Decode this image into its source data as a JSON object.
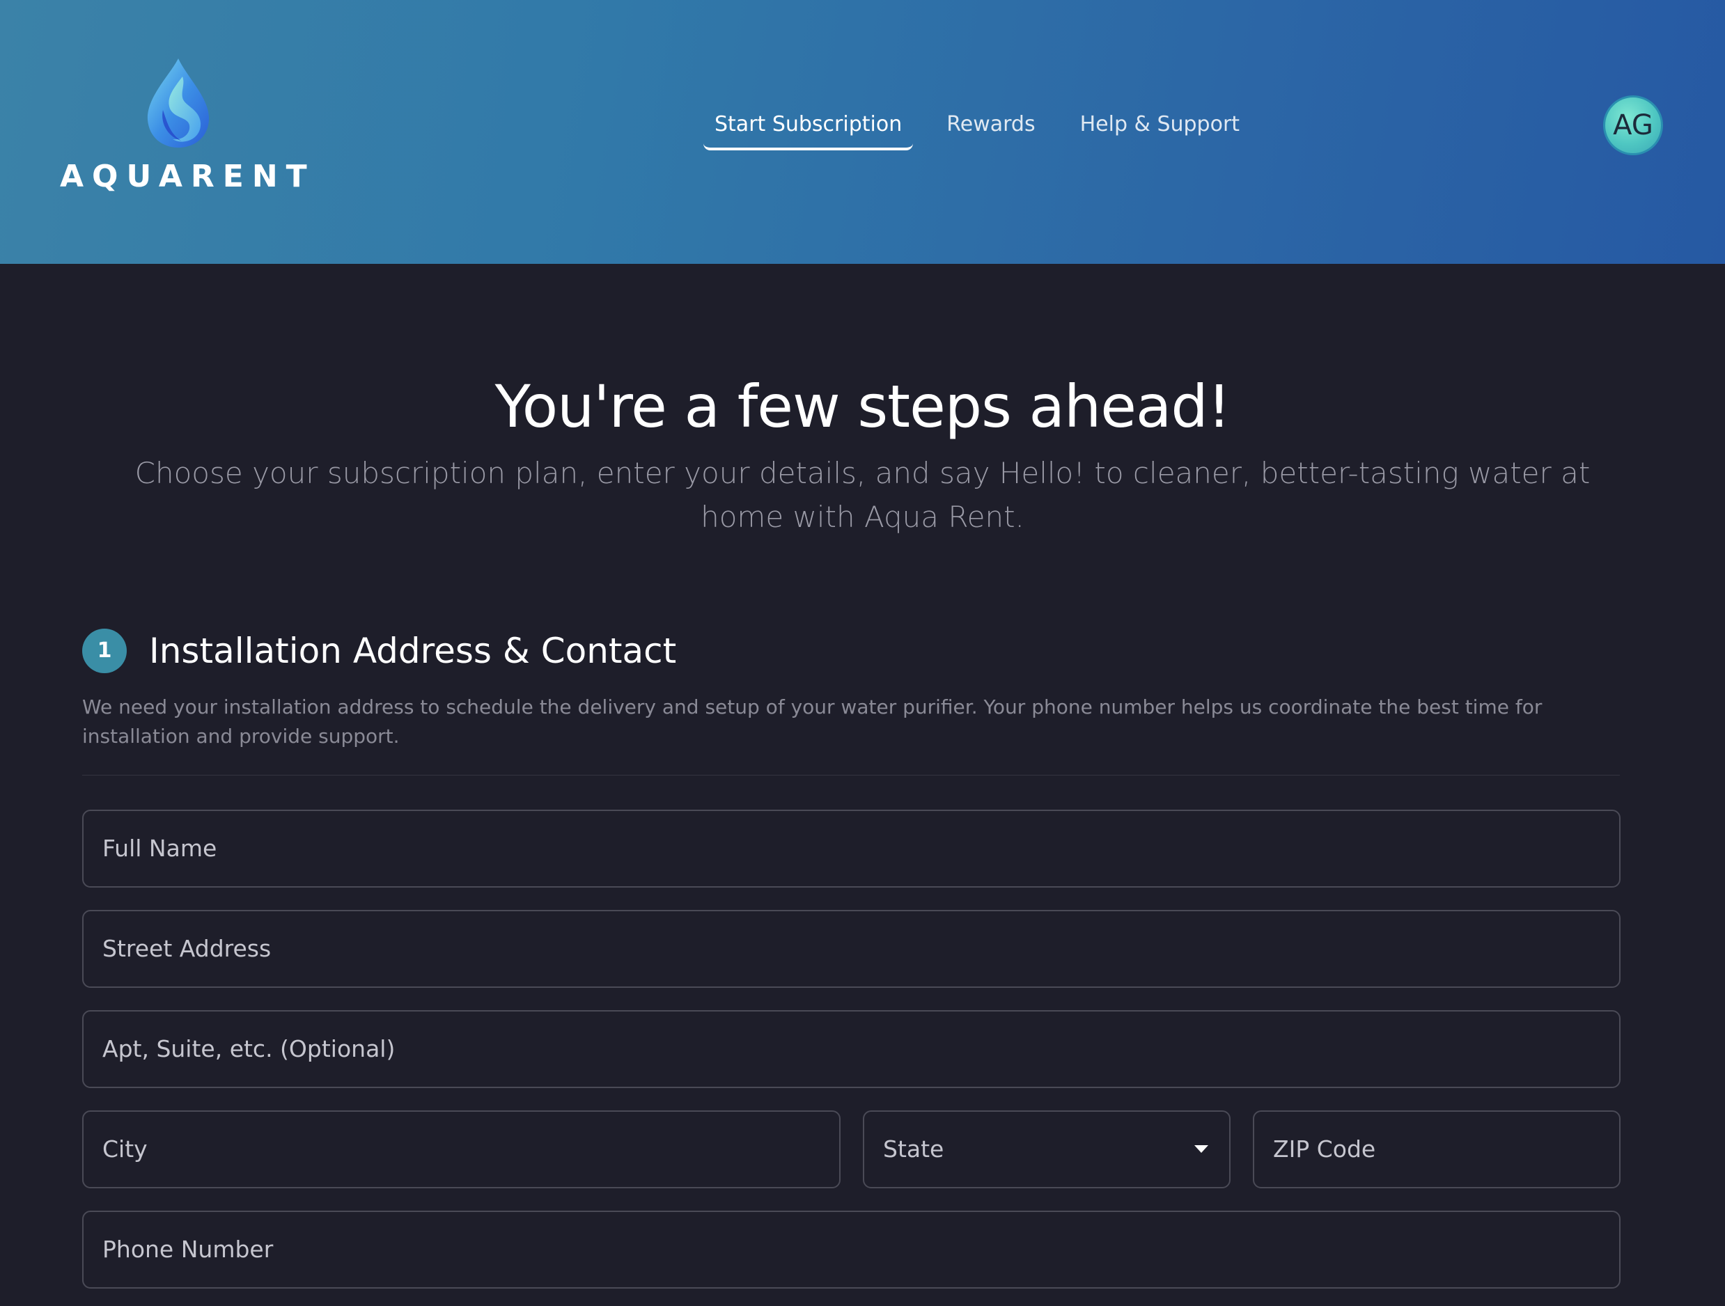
{
  "brand": {
    "name": "AQUARENT"
  },
  "nav": {
    "items": [
      {
        "label": "Start Subscription",
        "active": true
      },
      {
        "label": "Rewards",
        "active": false
      },
      {
        "label": "Help & Support",
        "active": false
      }
    ]
  },
  "user": {
    "initials": "AG"
  },
  "hero": {
    "title": "You're a few steps ahead!",
    "subtitle": "Choose your subscription plan, enter your details, and say Hello! to cleaner, better-tasting water at home with Aqua Rent."
  },
  "section": {
    "step": "1",
    "title": "Installation Address & Contact",
    "description": "We need your installation address to schedule the delivery and setup of your water purifier. Your phone number helps us coordinate the best time for installation and provide support."
  },
  "form": {
    "full_name": {
      "placeholder": "Full Name",
      "value": ""
    },
    "street": {
      "placeholder": "Street Address",
      "value": ""
    },
    "apt": {
      "placeholder": "Apt, Suite, etc. (Optional)",
      "value": ""
    },
    "city": {
      "placeholder": "City",
      "value": ""
    },
    "state": {
      "selected": "State"
    },
    "zip": {
      "placeholder": "ZIP Code",
      "value": ""
    },
    "phone": {
      "placeholder": "Phone Number",
      "value": ""
    }
  },
  "icons": {
    "logo": "water-drop-icon",
    "dropdown": "chevron-down-icon"
  },
  "colors": {
    "header_start": "#3b82a8",
    "header_end": "#2659a3",
    "background": "#1e1e2a",
    "step_badge": "#3a8ea6",
    "avatar": "#4fc7c2"
  }
}
